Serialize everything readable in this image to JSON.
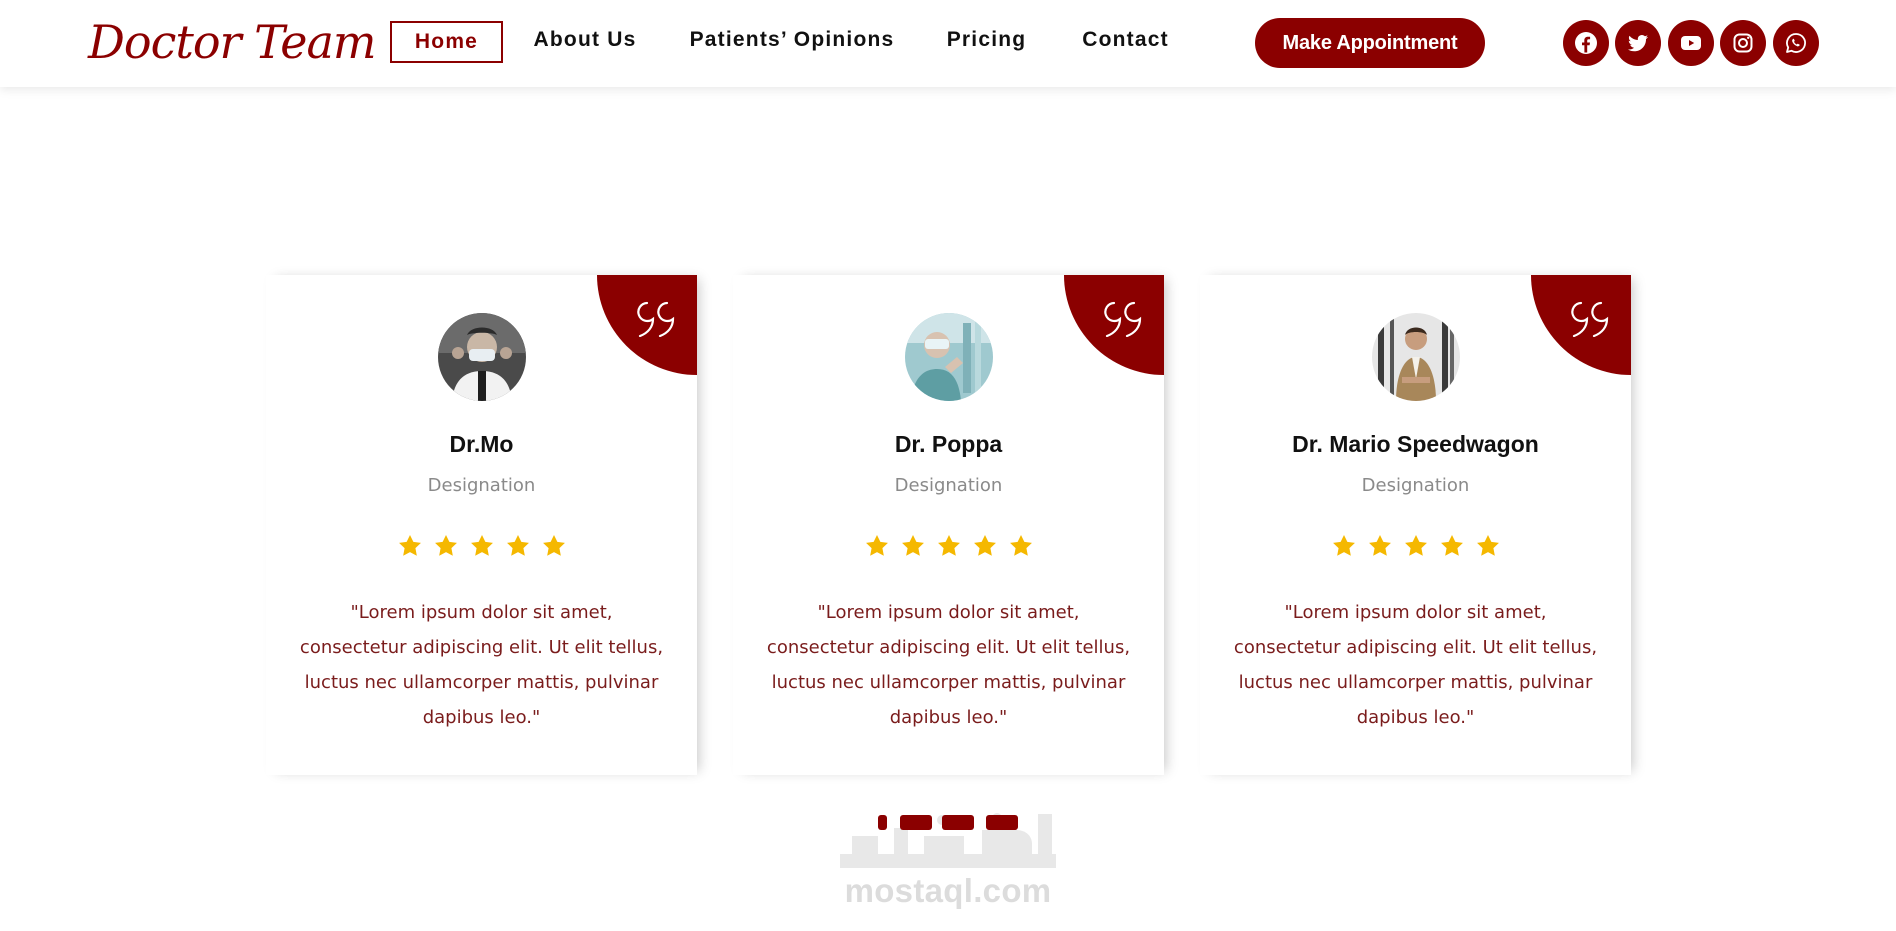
{
  "header": {
    "logo": "Doctor Team",
    "nav": [
      {
        "label": "Home",
        "active": true
      },
      {
        "label": "About Us",
        "active": false
      },
      {
        "label": "Patients’ Opinions",
        "active": false
      },
      {
        "label": "Pricing",
        "active": false
      },
      {
        "label": "Contact",
        "active": false
      }
    ],
    "cta_label": "Make Appointment",
    "social": [
      "facebook-icon",
      "twitter-icon",
      "youtube-icon",
      "instagram-icon",
      "whatsapp-icon"
    ]
  },
  "testimonials": [
    {
      "name": "Dr.Mo",
      "designation": "Designation",
      "rating": 5,
      "text": "\"Lorem ipsum dolor sit amet, consectetur adipiscing elit. Ut elit tellus, luctus nec ullamcorper mattis, pulvinar dapibus leo.\""
    },
    {
      "name": "Dr. Poppa",
      "designation": "Designation",
      "rating": 5,
      "text": "\"Lorem ipsum dolor sit amet, consectetur adipiscing elit. Ut elit tellus, luctus nec ullamcorper mattis, pulvinar dapibus leo.\""
    },
    {
      "name": "Dr. Mario Speedwagon",
      "designation": "Designation",
      "rating": 5,
      "text": "\"Lorem ipsum dolor sit amet, consectetur adipiscing elit. Ut elit tellus, luctus nec ullamcorper mattis, pulvinar dapibus leo.\""
    }
  ],
  "slider": {
    "dot_count": 4,
    "active_index": 0
  },
  "watermark": {
    "arabic": "مستقل",
    "latin": "mostaql.com"
  },
  "colors": {
    "accent": "#8b0000",
    "star": "#f5b800",
    "review_text": "#7a1c1c"
  }
}
